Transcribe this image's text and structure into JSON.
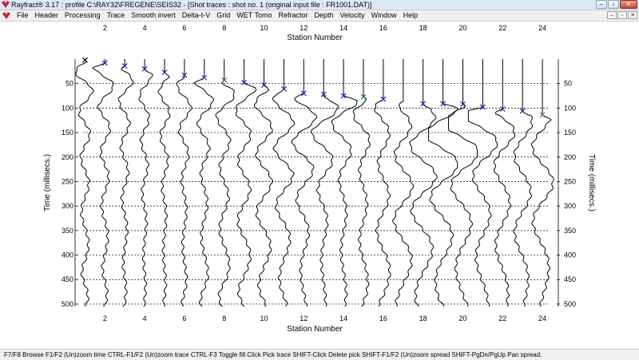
{
  "window": {
    "title": "Rayfract® 3.17 : profile C:\\RAY32\\FREGENE\\SEIS32 - [Shot traces : shot no. 1 (original input file : FR1001.DAT)]",
    "controls": [
      "–",
      "▫",
      "✕"
    ]
  },
  "menu": {
    "items": [
      "File",
      "Header",
      "Processing",
      "Trace",
      "Smooth invert",
      "Delta-t-V",
      "Grid",
      "WET Tomo",
      "Refractor",
      "Depth",
      "Velocity",
      "Window",
      "Help"
    ],
    "mdi_controls": [
      "–",
      "▫",
      "✕"
    ]
  },
  "chart_data": {
    "type": "seismic-traces",
    "title": "",
    "xlabel": "Station Number",
    "ylabel_left": "Time (millisecs.)",
    "ylabel_right": "Time (millisecs.)",
    "xlim": [
      0.5,
      24.6
    ],
    "ylim": [
      0,
      505
    ],
    "x_tick_labels": [
      "2",
      "4",
      "6",
      "8",
      "10",
      "12",
      "14",
      "16",
      "18",
      "20",
      "22",
      "24"
    ],
    "y_tick_labels": [
      "50",
      "100",
      "150",
      "200",
      "250",
      "300",
      "350",
      "400",
      "450",
      "500"
    ],
    "grid": "horizontal dotted lines every 50 ms",
    "trace_stations": [
      1,
      2,
      3,
      4,
      5,
      6,
      7,
      8,
      9,
      10,
      11,
      12,
      13,
      14,
      15,
      16,
      17,
      18,
      19,
      20,
      21,
      22,
      23,
      24
    ],
    "first_break_picks": [
      {
        "station": 1,
        "time_ms": 2,
        "color": "#000000"
      },
      {
        "station": 2,
        "time_ms": 8,
        "color": "#2020c0"
      },
      {
        "station": 3,
        "time_ms": 14,
        "color": "#2020c0"
      },
      {
        "station": 4,
        "time_ms": 20,
        "color": "#2020c0"
      },
      {
        "station": 5,
        "time_ms": 27,
        "color": "#2020c0"
      },
      {
        "station": 6,
        "time_ms": 33,
        "color": "#2020c0"
      },
      {
        "station": 7,
        "time_ms": 38,
        "color": "#6a3aa8"
      },
      {
        "station": 8,
        "time_ms": 43,
        "color": "#1a8a2a"
      },
      {
        "station": 9,
        "time_ms": 48,
        "color": "#2020c0"
      },
      {
        "station": 10,
        "time_ms": 53,
        "color": "#2020c0"
      },
      {
        "station": 11,
        "time_ms": 61,
        "color": "#2020c0"
      },
      {
        "station": 12,
        "time_ms": 70,
        "color": "#2020c0"
      },
      {
        "station": 13,
        "time_ms": 72,
        "color": "#2020c0"
      },
      {
        "station": 14,
        "time_ms": 75,
        "color": "#2020c0"
      },
      {
        "station": 15,
        "time_ms": 77,
        "color": "#1a8a2a"
      },
      {
        "station": 16,
        "time_ms": 82,
        "color": "#2020c0"
      },
      {
        "station": 18,
        "time_ms": 91,
        "color": "#2020c0"
      },
      {
        "station": 19,
        "time_ms": 91,
        "color": "#2020c0"
      },
      {
        "station": 20,
        "time_ms": 92,
        "color": "#2020c0"
      },
      {
        "station": 21,
        "time_ms": 98,
        "color": "#2020c0"
      },
      {
        "station": 22,
        "time_ms": 102,
        "color": "#2020c0"
      },
      {
        "station": 23,
        "time_ms": 106,
        "color": "#2020c0"
      },
      {
        "station": 24,
        "time_ms": 114,
        "color": "#777777"
      }
    ]
  },
  "statusbar": {
    "text": "F7/F8 Browse   F1/F2 (Un)zoom time   CTRL-F1/F2 (Un)zoom trace   CTRL-F3 Toggle fill   Click Pick trace   SHIFT-Click Delete pick   SHIFT-F1/F2 (Un)zoom spread   SHIFT-PgDn/PgUp Pan spread."
  }
}
